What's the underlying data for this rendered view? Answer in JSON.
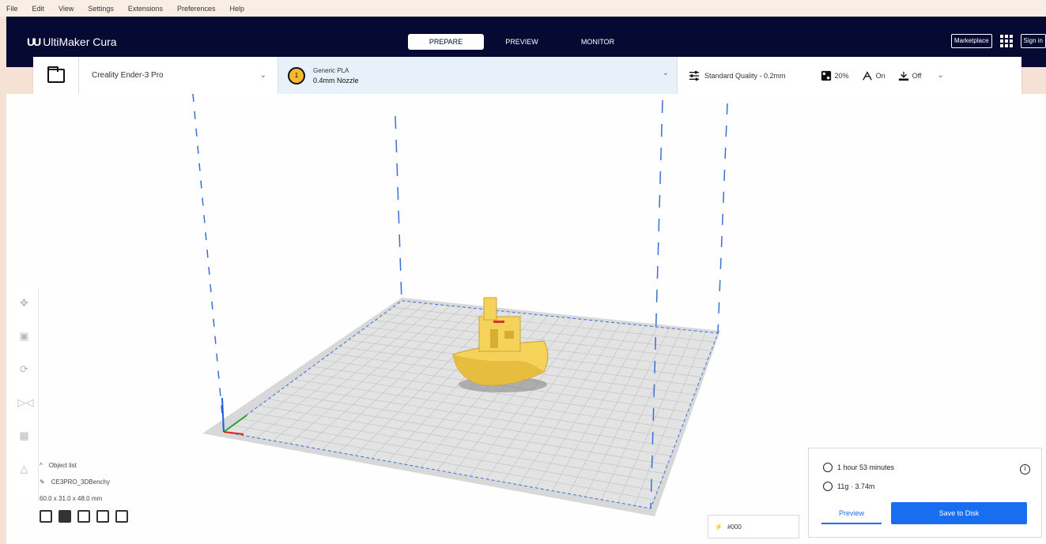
{
  "menu": {
    "items": [
      "File",
      "Edit",
      "View",
      "Settings",
      "Extensions",
      "Preferences",
      "Help"
    ]
  },
  "header": {
    "app_title": "UltiMaker Cura",
    "logo_mark": "UU",
    "stages": [
      {
        "label": "PREPARE",
        "active": true
      },
      {
        "label": "PREVIEW",
        "active": false
      },
      {
        "label": "MONITOR",
        "active": false
      }
    ],
    "marketplace_label": "Marketplace",
    "signin_label": "Sign in"
  },
  "config": {
    "printer_name": "Creality Ender-3 Pro",
    "material_type": "Generic PLA",
    "nozzle": "0.4mm Nozzle",
    "extruder_number": "1",
    "profile": "Standard Quality - 0.2mm",
    "support_value": "20%",
    "adhesion_value": "On",
    "infill_value": "Off"
  },
  "viewport": {
    "colors": {
      "build_plate": "#d8d8d8",
      "grid": "#c4c4c4",
      "boundary": "#3a6fd6",
      "model": "#f5d25a"
    }
  },
  "tools": [
    "move-icon",
    "scale-icon",
    "rotate-icon",
    "mirror-icon",
    "per-model-settings-icon",
    "support-blocker-icon"
  ],
  "object": {
    "list_label": "Object list",
    "name": "CE3PRO_3DBenchy",
    "dimensions": "60.0 x 31.0 x 48.0 mm",
    "view_icons": [
      "3d-view-icon",
      "front-view-icon",
      "top-view-icon",
      "left-view-icon",
      "right-view-icon"
    ]
  },
  "layer": {
    "value": "#000"
  },
  "print": {
    "time": "1 hour 53 minutes",
    "material": "11g · 3.74m",
    "preview_label": "Preview",
    "save_label": "Save to Disk"
  }
}
